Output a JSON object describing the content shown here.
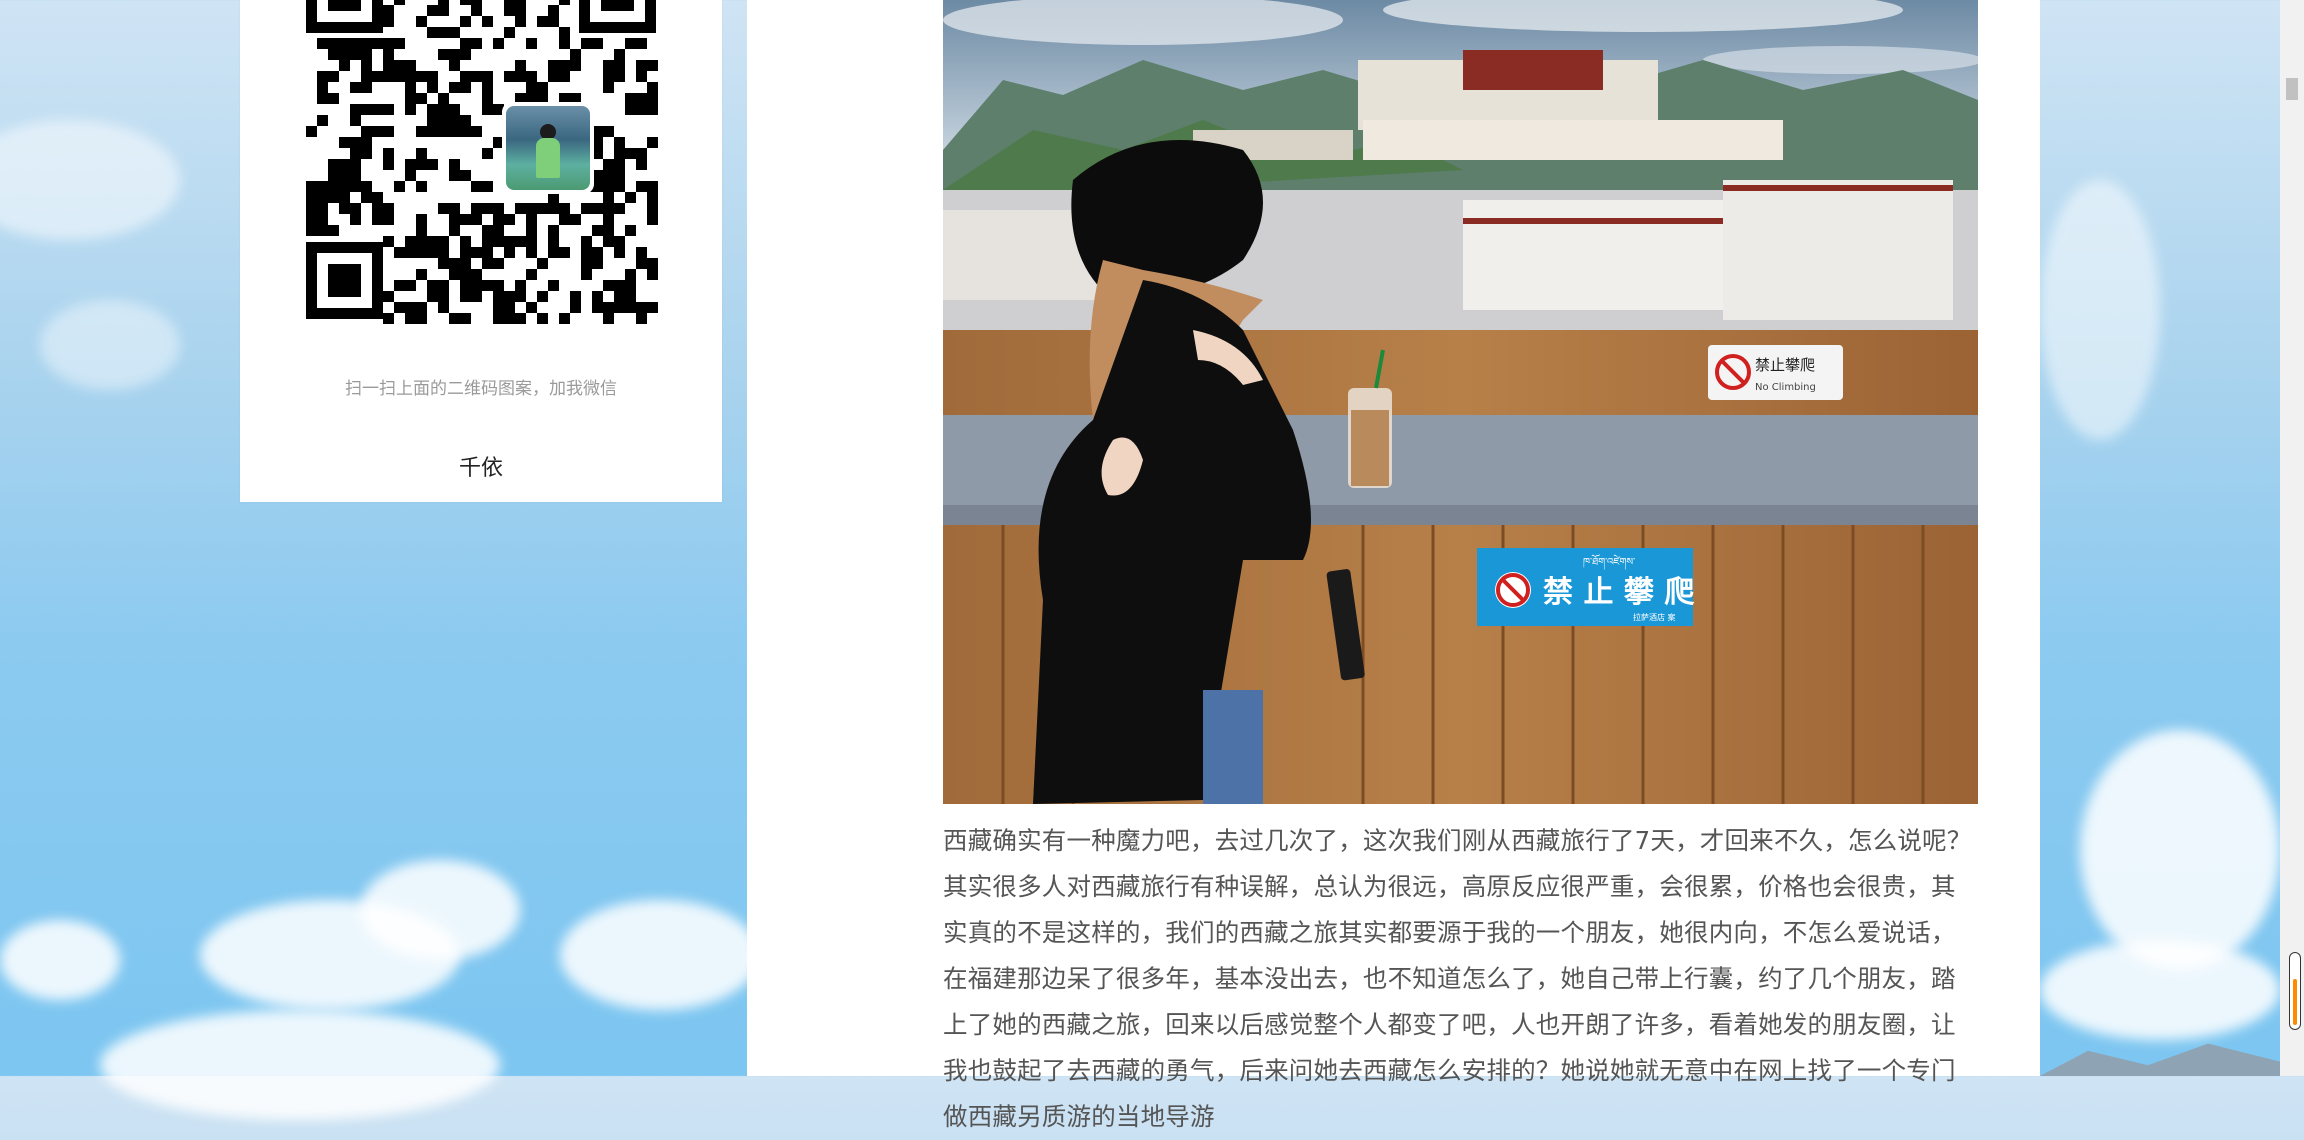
{
  "sidebar": {
    "qr_caption": "扫一扫上面的二维码图案，加我微信",
    "wechat_name": "千依"
  },
  "article": {
    "photo_signs": {
      "sign_small_title": "禁止攀爬",
      "sign_small_sub": "No Climbing",
      "sign_big_top": "ཁ་ཐོག་འཛེགས་",
      "sign_big_text": "禁 止 攀 爬",
      "sign_big_small": "拉萨酒店 案"
    },
    "paragraph": "西藏确实有一种魔力吧，去过几次了，这次我们刚从西藏旅行了7天，才回来不久，怎么说呢？其实很多人对西藏旅行有种误解，总认为很远，高原反应很严重，会很累，价格也会很贵，其实真的不是这样的，我们的西藏之旅其实都要源于我的一个朋友，她很内向，不怎么爱说话，在福建那边呆了很多年，基本没出去，也不知道怎么了，她自己带上行囊，约了几个朋友，踏上了她的西藏之旅，回来以后感觉整个人都变了吧，人也开朗了许多，看着她发的朋友圈，让我也鼓起了去西藏的勇气，后来问她去西藏怎么安排的？她说她就无意中在网上找了一个专门做西藏另质游的当地导游"
  }
}
